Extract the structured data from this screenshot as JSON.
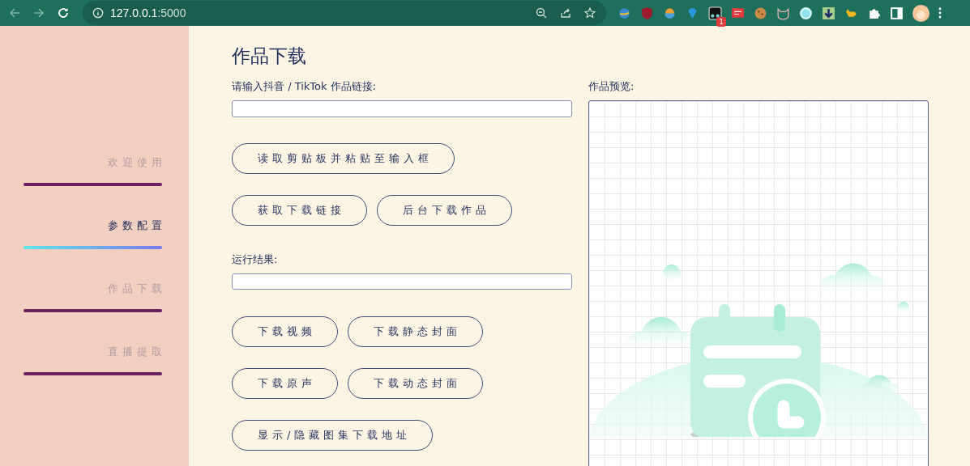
{
  "browser": {
    "url_host": "127.0.0.1",
    "url_port": ":5000",
    "extension_badge": "1"
  },
  "sidebar": {
    "items": [
      {
        "label": "欢迎使用",
        "selected": false
      },
      {
        "label": "参数配置",
        "selected": true
      },
      {
        "label": "作品下载",
        "selected": false
      },
      {
        "label": "直播提取",
        "selected": false
      }
    ]
  },
  "page": {
    "title": "作品下载",
    "link_label": "请输入抖音 / TikTok 作品链接:",
    "link_buttons": [
      [
        "读取剪贴板并粘贴至输入框"
      ],
      [
        "获取下载链接",
        "后台下载作品"
      ]
    ],
    "result_label": "运行结果:",
    "result_buttons": [
      [
        "下载视频",
        "下载静态封面"
      ],
      [
        "下载原声",
        "下载动态封面"
      ],
      [
        "显示/隐藏图集下载地址"
      ]
    ],
    "preview_label": "作品预览:"
  }
}
